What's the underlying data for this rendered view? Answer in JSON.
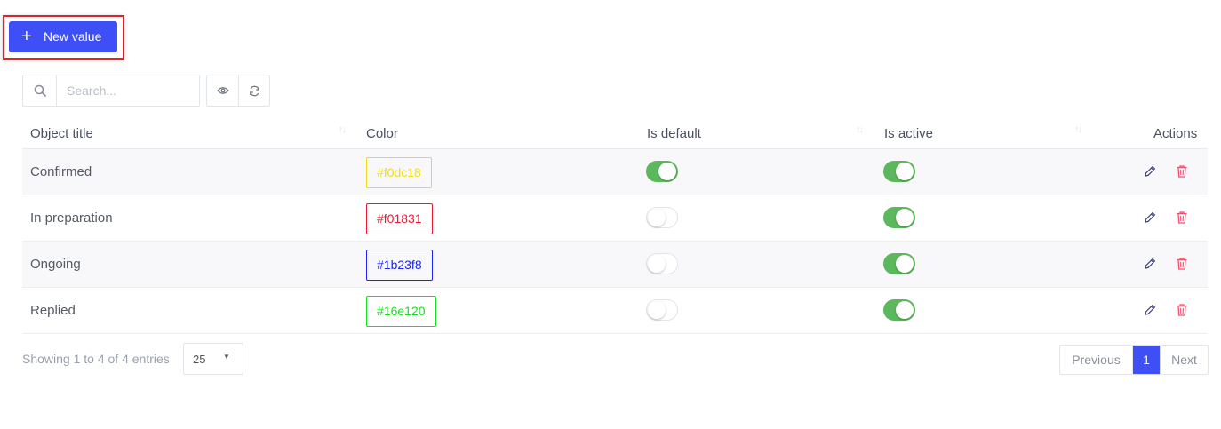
{
  "toolbar": {
    "new_button_icon": "plus",
    "new_button_label": "New value",
    "search_placeholder": "Search...",
    "search_icon": "search-icon",
    "view_icon": "eye-icon",
    "refresh_icon": "refresh-icon"
  },
  "table": {
    "headers": {
      "title": "Object title",
      "color": "Color",
      "is_default": "Is default",
      "is_active": "Is active",
      "actions": "Actions"
    },
    "rows": [
      {
        "title": "Confirmed",
        "color": "#f0dc18",
        "is_default": true,
        "is_active": true
      },
      {
        "title": "In preparation",
        "color": "#f01831",
        "is_default": false,
        "is_active": true
      },
      {
        "title": "Ongoing",
        "color": "#1b23f8",
        "is_default": false,
        "is_active": true
      },
      {
        "title": "Replied",
        "color": "#16e120",
        "is_default": false,
        "is_active": true
      }
    ]
  },
  "footer": {
    "info": "Showing 1 to 4 of 4 entries",
    "page_length": "25",
    "pagination": {
      "previous": "Previous",
      "current": "1",
      "next": "Next"
    }
  },
  "colors": {
    "primary": "#3d4ff5",
    "toggle_on": "#5cb85c",
    "edit_icon": "#3a3f73",
    "delete_icon": "#f0506e",
    "highlight": "#d9262a"
  }
}
